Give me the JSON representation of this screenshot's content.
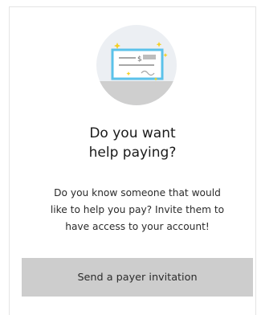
{
  "card": {
    "title_lines": [
      "Do you want",
      "help paying?"
    ],
    "description_lines": [
      "Do you know someone that would",
      "like to help you pay? Invite them to",
      "have access to your account!"
    ],
    "button_label": "Send a payer invitation",
    "check_amount_symbol": "$",
    "illustration_icon": "check-payment-icon"
  },
  "colors": {
    "circle_bg": "#eceff3",
    "check_fill": "#ffffff",
    "check_border": "#5bc2ea",
    "sparkle": "#f5d024",
    "button_bg": "#cdcdcd",
    "border": "#e4e4e4"
  }
}
